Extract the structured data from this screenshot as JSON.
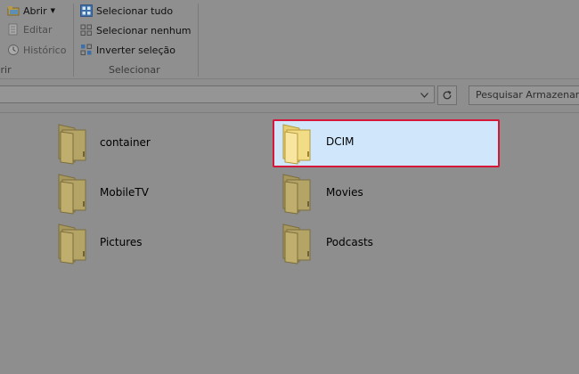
{
  "ribbon": {
    "open_group": {
      "open_label": "Abrir",
      "edit_label": "Editar",
      "history_label": "Histórico",
      "group_label": "Abrir"
    },
    "select_group": {
      "select_all_label": "Selecionar tudo",
      "select_none_label": "Selecionar nenhum",
      "invert_label": "Inverter seleção",
      "group_label": "Selecionar"
    }
  },
  "address": {
    "search_placeholder": "Pesquisar Armazenamento"
  },
  "folders": [
    {
      "name": "container",
      "selected": false
    },
    {
      "name": "DCIM",
      "selected": true
    },
    {
      "name": "MobileTV",
      "selected": false
    },
    {
      "name": "Movies",
      "selected": false
    },
    {
      "name": "Pictures",
      "selected": false
    },
    {
      "name": "Podcasts",
      "selected": false
    }
  ],
  "colors": {
    "selection_bg": "#cfe6fb",
    "selection_border": "#d6173a",
    "overlay_bg": "#8e8e8e"
  }
}
